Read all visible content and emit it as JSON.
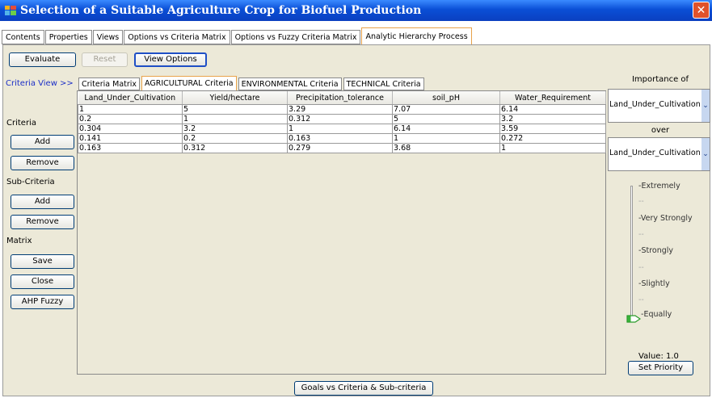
{
  "window": {
    "title": "Selection of a Suitable Agriculture Crop for Biofuel Production",
    "close_glyph": "✕"
  },
  "main_tabs": [
    {
      "label": "Contents",
      "active": false
    },
    {
      "label": "Properties",
      "active": false
    },
    {
      "label": "Views",
      "active": false
    },
    {
      "label": "Options vs Criteria Matrix",
      "active": false
    },
    {
      "label": "Options vs Fuzzy Criteria Matrix",
      "active": false
    },
    {
      "label": "Analytic Hierarchy Process",
      "active": true
    }
  ],
  "toolbar": {
    "evaluate": "Evaluate",
    "reset": "Reset",
    "view_options": "View Options"
  },
  "criteria_view_label": "Criteria View >>",
  "sub_tabs": [
    {
      "label": "Criteria Matrix",
      "active": false
    },
    {
      "label": "AGRICULTURAL Criteria",
      "active": true
    },
    {
      "label": "ENVIRONMENTAL Criteria",
      "active": false
    },
    {
      "label": "TECHNICAL Criteria",
      "active": false
    }
  ],
  "left_panel": {
    "criteria": "Criteria",
    "add": "Add",
    "remove": "Remove",
    "sub_criteria": "Sub-Criteria",
    "add2": "Add",
    "remove2": "Remove",
    "matrix": "Matrix",
    "save": "Save",
    "close": "Close",
    "ahp_fuzzy": "AHP Fuzzy"
  },
  "table": {
    "columns": [
      "Land_Under_Cultivation",
      "Yield/hectare",
      "Precipitation_tolerance",
      "soil_pH",
      "Water_Requirement"
    ],
    "rows": [
      [
        "1",
        "5",
        "3.29",
        "7.07",
        "6.14"
      ],
      [
        "0.2",
        "1",
        "0.312",
        "5",
        "3.2"
      ],
      [
        "0.304",
        "3.2",
        "1",
        "6.14",
        "3.59"
      ],
      [
        "0.141",
        "0.2",
        "0.163",
        "1",
        "0.272"
      ],
      [
        "0.163",
        "0.312",
        "0.279",
        "3.68",
        "1"
      ]
    ]
  },
  "right_panel": {
    "importance_of": "Importance of",
    "combo1": "Land_Under_Cultivation",
    "over": "over",
    "combo2": "Land_Under_Cultivation",
    "scale": {
      "extremely": "Extremely",
      "very_strongly": "Very Strongly",
      "strongly": "Strongly",
      "slightly": "Slightly",
      "equally": "Equally",
      "tick": "--"
    },
    "value": "Value: 1.0",
    "set_priority": "Set Priority",
    "slider_value": 1.0
  },
  "bottom": {
    "goals": "Goals vs Criteria & Sub-criteria"
  },
  "colors": {
    "accent": "#0a4fd6",
    "tab_highlight": "#e8a24a",
    "link_blue": "#1c2fc7"
  }
}
